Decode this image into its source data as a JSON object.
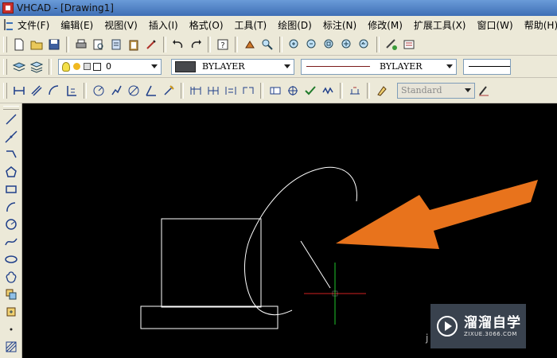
{
  "window": {
    "title": "VHCAD - [Drawing1]"
  },
  "menubar": {
    "items": [
      {
        "label": "文件(F)"
      },
      {
        "label": "编辑(E)"
      },
      {
        "label": "视图(V)"
      },
      {
        "label": "插入(I)"
      },
      {
        "label": "格式(O)"
      },
      {
        "label": "工具(T)"
      },
      {
        "label": "绘图(D)"
      },
      {
        "label": "标注(N)"
      },
      {
        "label": "修改(M)"
      },
      {
        "label": "扩展工具(X)"
      },
      {
        "label": "窗口(W)"
      },
      {
        "label": "帮助(H)"
      }
    ]
  },
  "properties_bar": {
    "layer": "0",
    "color": "BYLAYER",
    "linetype": "BYLAYER",
    "text_style": "Standard"
  },
  "watermark": {
    "text": "溜溜自学",
    "subtext": "ZIXUE.3066.COM"
  },
  "colors": {
    "arrow": "#e8731c",
    "canvas": "#000000",
    "crosshair_x": "#d0201f",
    "crosshair_y": "#21c32a",
    "drawing": "#ffffff"
  },
  "icons": [
    "new-icon",
    "open-icon",
    "save-icon",
    "print-icon",
    "preview-icon",
    "publish-icon",
    "paste-icon",
    "match-icon",
    "undo-icon",
    "redo-icon",
    "help-icon",
    "pan-icon",
    "zoom-realtime-icon",
    "zoom-in-icon",
    "zoom-out-icon",
    "zoom-window-icon",
    "zoom-extents-icon",
    "zoom-previous-icon",
    "layer-manager-icon",
    "layer-state-icon",
    "line-icon",
    "xline-icon",
    "pline-icon",
    "polygon-icon",
    "rectangle-icon",
    "arc-icon",
    "circle-icon",
    "spline-icon",
    "ellipse-icon",
    "revcloud-icon",
    "block-icon",
    "insert-icon",
    "point-icon",
    "hatch-icon"
  ]
}
